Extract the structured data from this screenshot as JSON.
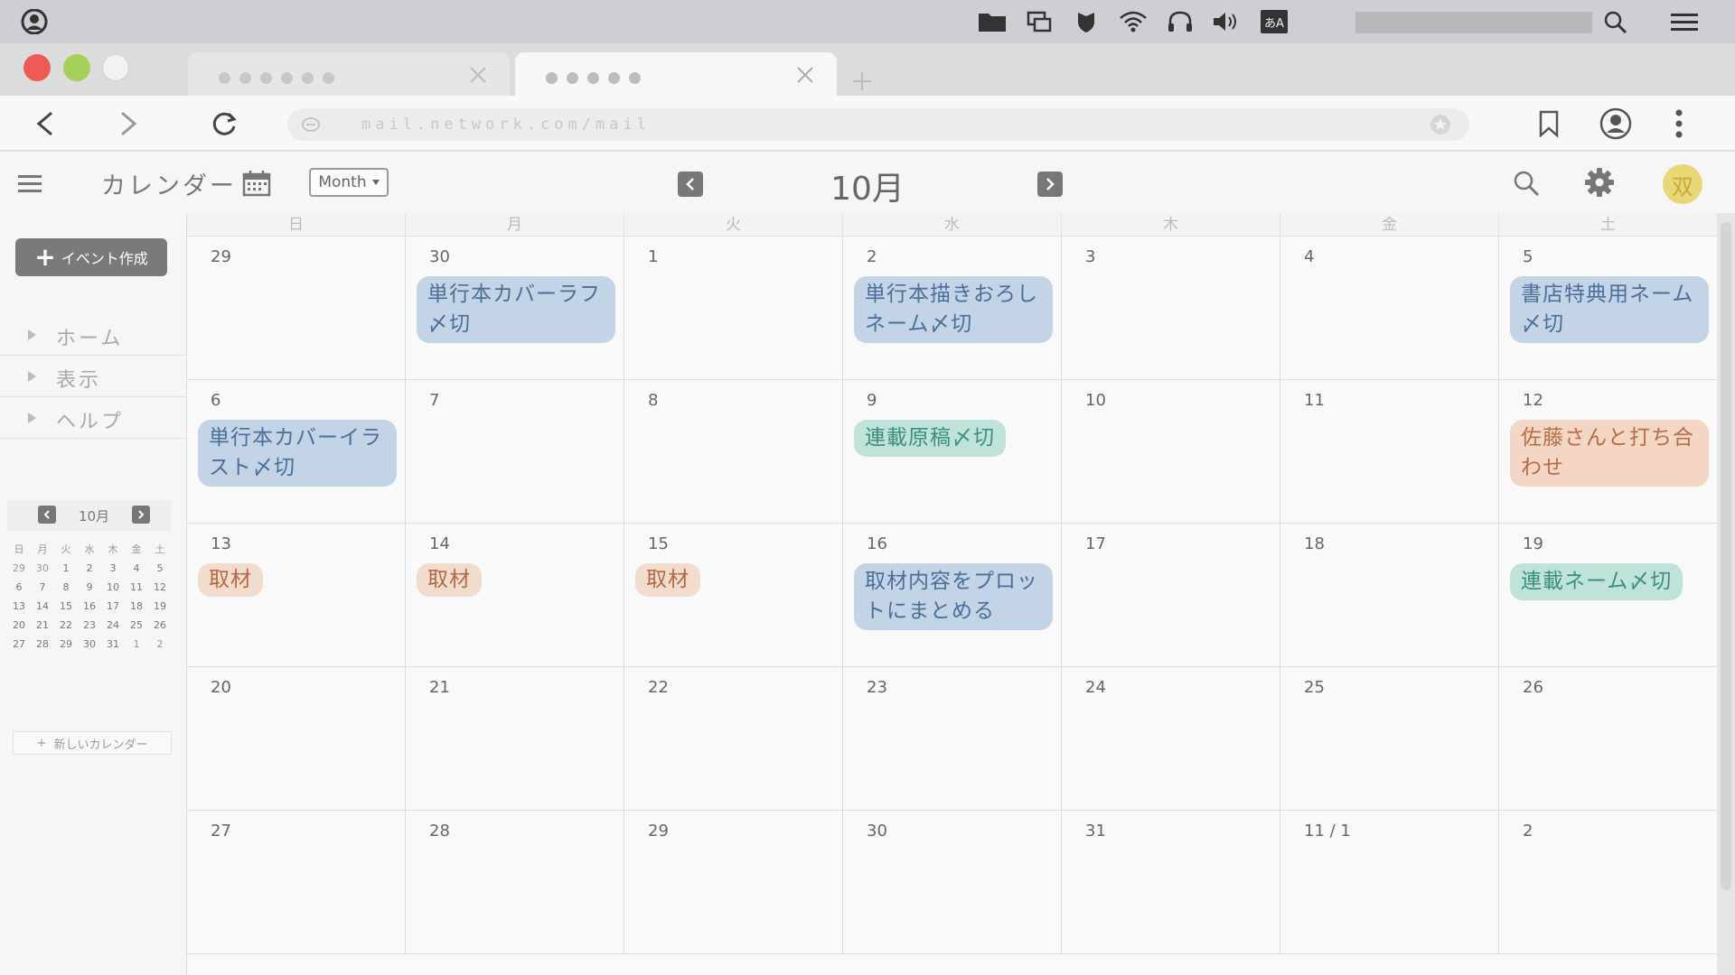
{
  "colors": {
    "accent_gray": "#777777",
    "event_blue": "#c2d4e6",
    "event_teal": "#bfe3d8",
    "event_orange": "#f3d6c4",
    "avatar": "#e8d776"
  },
  "os_bar": {
    "icons": [
      "user-icon",
      "folder-icon",
      "windows-icon",
      "shield-icon",
      "wifi-icon",
      "headphones-icon",
      "volume-icon",
      "input-method-icon",
      "search-icon",
      "menu-icon"
    ],
    "input_method_label": "あA"
  },
  "browser": {
    "tabs": [
      {
        "label": "●●●●●●"
      },
      {
        "label": "●●●●●"
      }
    ],
    "url": "mail.network.com/mail"
  },
  "app": {
    "title": "カレンダー",
    "view_select": "Month",
    "month_title": "10月",
    "avatar_text": "双"
  },
  "sidebar": {
    "create_button": "イベント作成",
    "nav_items": [
      {
        "label": "ホーム"
      },
      {
        "label": "表示"
      },
      {
        "label": "ヘルプ"
      }
    ],
    "mini_calendar": {
      "title": "10月",
      "weekdays": [
        "日",
        "月",
        "火",
        "水",
        "木",
        "金",
        "土"
      ],
      "days": [
        "29",
        "30",
        "1",
        "2",
        "3",
        "4",
        "5",
        "6",
        "7",
        "8",
        "9",
        "10",
        "11",
        "12",
        "13",
        "14",
        "15",
        "16",
        "17",
        "18",
        "19",
        "20",
        "21",
        "22",
        "23",
        "24",
        "25",
        "26",
        "27",
        "28",
        "29",
        "30",
        "31",
        "1",
        "2"
      ]
    },
    "new_calendar_button": "新しいカレンダー"
  },
  "calendar": {
    "weekdays": [
      "日",
      "月",
      "火",
      "水",
      "木",
      "金",
      "土"
    ],
    "weeks": [
      [
        {
          "day": "29",
          "events": []
        },
        {
          "day": "30",
          "events": [
            {
              "title": "単行本カバーラフ〆切",
              "color": "blue"
            }
          ]
        },
        {
          "day": "1",
          "events": []
        },
        {
          "day": "2",
          "events": [
            {
              "title": "単行本描きおろしネーム〆切",
              "color": "blue"
            }
          ]
        },
        {
          "day": "3",
          "events": []
        },
        {
          "day": "4",
          "events": []
        },
        {
          "day": "5",
          "events": [
            {
              "title": "書店特典用ネーム〆切",
              "color": "blue"
            }
          ]
        }
      ],
      [
        {
          "day": "6",
          "events": [
            {
              "title": "単行本カバーイラスト〆切",
              "color": "blue"
            }
          ]
        },
        {
          "day": "7",
          "events": []
        },
        {
          "day": "8",
          "events": []
        },
        {
          "day": "9",
          "events": [
            {
              "title": "連載原稿〆切",
              "color": "teal"
            }
          ]
        },
        {
          "day": "10",
          "events": []
        },
        {
          "day": "11",
          "events": []
        },
        {
          "day": "12",
          "events": [
            {
              "title": "佐藤さんと打ち合わせ",
              "color": "orange"
            }
          ]
        }
      ],
      [
        {
          "day": "13",
          "events": [
            {
              "title": "取材",
              "color": "tag"
            }
          ]
        },
        {
          "day": "14",
          "events": [
            {
              "title": "取材",
              "color": "tag"
            }
          ]
        },
        {
          "day": "15",
          "events": [
            {
              "title": "取材",
              "color": "tag"
            }
          ]
        },
        {
          "day": "16",
          "events": [
            {
              "title": "取材内容をプロットにまとめる",
              "color": "blue"
            }
          ]
        },
        {
          "day": "17",
          "events": []
        },
        {
          "day": "18",
          "events": []
        },
        {
          "day": "19",
          "events": [
            {
              "title": "連載ネーム〆切",
              "color": "teal"
            }
          ]
        }
      ],
      [
        {
          "day": "20",
          "events": []
        },
        {
          "day": "21",
          "events": []
        },
        {
          "day": "22",
          "events": []
        },
        {
          "day": "23",
          "events": []
        },
        {
          "day": "24",
          "events": []
        },
        {
          "day": "25",
          "events": []
        },
        {
          "day": "26",
          "events": []
        }
      ],
      [
        {
          "day": "27",
          "events": []
        },
        {
          "day": "28",
          "events": []
        },
        {
          "day": "29",
          "events": []
        },
        {
          "day": "30",
          "events": []
        },
        {
          "day": "31",
          "events": []
        },
        {
          "day": "11 / 1",
          "events": []
        },
        {
          "day": "2",
          "events": []
        }
      ]
    ]
  }
}
